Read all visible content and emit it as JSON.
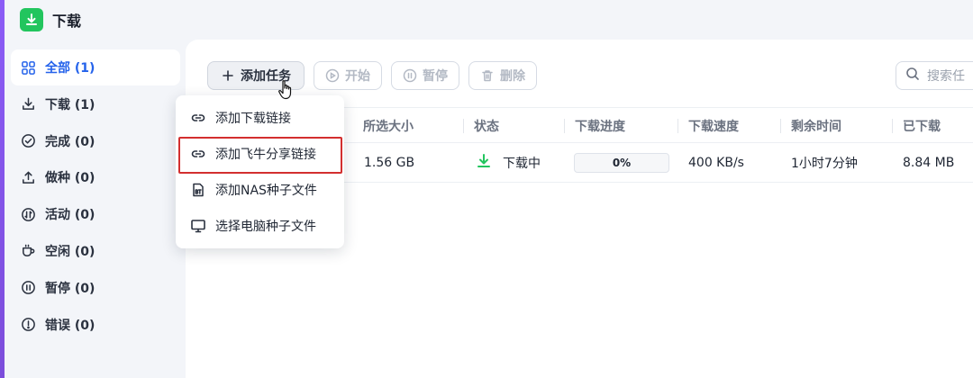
{
  "app": {
    "title": "下载"
  },
  "sidebar": {
    "items": [
      {
        "label": "全部 (1)",
        "icon": "grid-icon",
        "active": true
      },
      {
        "label": "下载 (1)",
        "icon": "download-icon"
      },
      {
        "label": "完成 (0)",
        "icon": "check-circle-icon"
      },
      {
        "label": "做种 (0)",
        "icon": "upload-icon"
      },
      {
        "label": "活动 (0)",
        "icon": "activity-icon"
      },
      {
        "label": "空闲 (0)",
        "icon": "cup-icon"
      },
      {
        "label": "暂停 (0)",
        "icon": "pause-circle-icon"
      },
      {
        "label": "错误 (0)",
        "icon": "error-circle-icon"
      }
    ]
  },
  "toolbar": {
    "add_label": "添加任务",
    "start_label": "开始",
    "pause_label": "暂停",
    "delete_label": "删除"
  },
  "search": {
    "placeholder": "搜索任"
  },
  "table": {
    "headers": {
      "size": "所选大小",
      "status": "状态",
      "progress": "下载进度",
      "speed": "下载速度",
      "remaining": "剩余时间",
      "downloaded": "已下载"
    },
    "rows": [
      {
        "size": "1.56 GB",
        "status": "下载中",
        "progress": "0%",
        "speed": "400 KB/s",
        "remaining": "1小时7分钟",
        "downloaded": "8.84 MB"
      }
    ]
  },
  "menu": {
    "items": [
      {
        "label": "添加下载链接",
        "icon": "link-icon"
      },
      {
        "label": "添加飞牛分享链接",
        "icon": "link-icon",
        "highlighted": true
      },
      {
        "label": "添加NAS种子文件",
        "icon": "bt-file-icon"
      },
      {
        "label": "选择电脑种子文件",
        "icon": "monitor-icon"
      }
    ]
  },
  "colors": {
    "accent": "#2563eb",
    "logo": "#22c55e",
    "highlight": "#d32f2f",
    "status_download": "#22c55e"
  }
}
